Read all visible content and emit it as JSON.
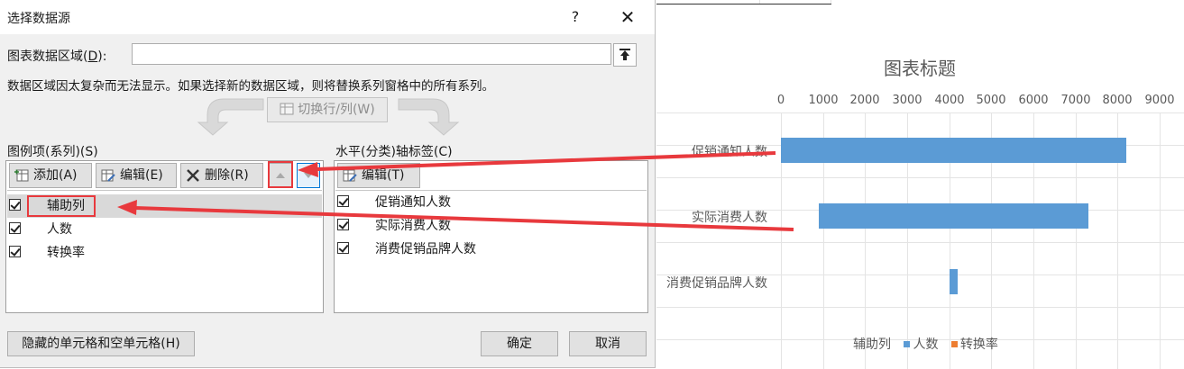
{
  "dialog": {
    "title": "选择数据源",
    "help": "?",
    "close": "✕",
    "range_label_prefix": "图表数据区域(",
    "range_label_key": "D",
    "range_label_suffix": "):",
    "range_value": "",
    "warning": "数据区域因太复杂而无法显示。如果选择新的数据区域，则将替换系列窗格中的所有系列。",
    "switch_button": "切换行/列(W)"
  },
  "series_panel": {
    "label": "图例项(系列)(S)",
    "add": "添加(A)",
    "edit": "编辑(E)",
    "delete": "删除(R)",
    "items": [
      {
        "label": "辅助列",
        "checked": true
      },
      {
        "label": "人数",
        "checked": true
      },
      {
        "label": "转换率",
        "checked": true
      }
    ]
  },
  "axis_panel": {
    "label": "水平(分类)轴标签(C)",
    "edit": "编辑(T)",
    "items": [
      {
        "label": "促销通知人数",
        "checked": true
      },
      {
        "label": "实际消费人数",
        "checked": true
      },
      {
        "label": "消费促销品牌人数",
        "checked": true
      }
    ]
  },
  "footer": {
    "hidden_cells": "隐藏的单元格和空单元格(H)",
    "ok": "确定",
    "cancel": "取消"
  },
  "colors": {
    "bar": "#5b9bd5",
    "conversion": "#ed7d31",
    "annotation": "#e8393d"
  },
  "chart_data": {
    "type": "bar",
    "orientation": "horizontal-stacked",
    "title": "图表标题",
    "xlim": [
      0,
      9000
    ],
    "ticks": [
      "0",
      "1000",
      "2000",
      "3000",
      "4000",
      "5000",
      "6000",
      "7000",
      "8000",
      "9000"
    ],
    "categories": [
      "促销通知人数",
      "实际消费人数",
      "消费促销品牌人数"
    ],
    "series": [
      {
        "name": "辅助列",
        "values": [
          0,
          900,
          4000
        ],
        "visible": false
      },
      {
        "name": "人数",
        "values": [
          8200,
          6400,
          200
        ]
      },
      {
        "name": "转换率",
        "values": [
          0,
          0,
          0
        ]
      }
    ],
    "legend_position": "bottom",
    "grid": true
  }
}
